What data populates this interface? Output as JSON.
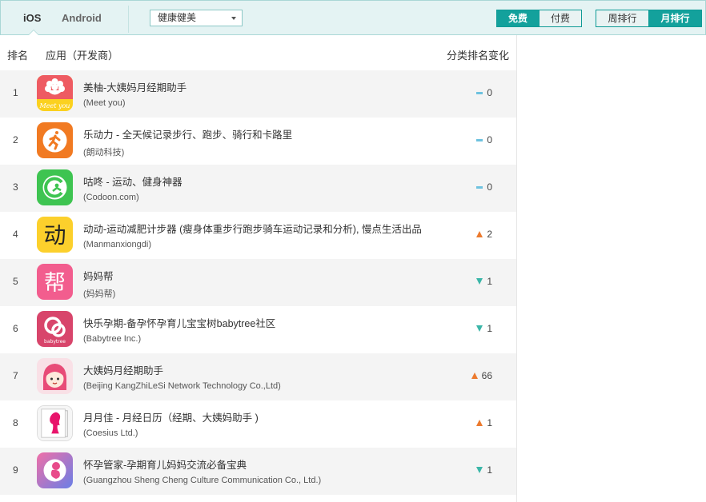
{
  "platform_tabs": [
    {
      "label": "iOS",
      "active": true
    },
    {
      "label": "Android",
      "active": false
    }
  ],
  "category_select": {
    "value": "健康健美"
  },
  "pay_toggle": [
    {
      "label": "免费",
      "active": true
    },
    {
      "label": "付费",
      "active": false
    }
  ],
  "period_toggle": [
    {
      "label": "周排行",
      "active": false
    },
    {
      "label": "月排行",
      "active": true
    }
  ],
  "table": {
    "headers": {
      "rank": "排名",
      "app": "应用（开发商）",
      "change": "分类排名变化"
    },
    "rows": [
      {
        "rank": "1",
        "name": "美柚-大姨妈月经期助手",
        "developer": "(Meet you)",
        "change_dir": "same",
        "change": "0",
        "icon": "meetyou-flower-icon"
      },
      {
        "rank": "2",
        "name": "乐动力 - 全天候记录步行、跑步、骑行和卡路里",
        "developer": "(朗动科技)",
        "change_dir": "same",
        "change": "0",
        "icon": "runner-icon"
      },
      {
        "rank": "3",
        "name": "咕咚 - 运动、健身神器",
        "developer": "(Codoon.com)",
        "change_dir": "same",
        "change": "0",
        "icon": "codoon-icon"
      },
      {
        "rank": "4",
        "name": "动动-运动减肥计步器 (瘦身体重步行跑步骑车运动记录和分析), 慢点生活出品",
        "developer": "(Manmanxiongdi)",
        "change_dir": "up",
        "change": "2",
        "icon": "dongdong-icon"
      },
      {
        "rank": "5",
        "name": "妈妈帮",
        "developer": "(妈妈帮)",
        "change_dir": "down",
        "change": "1",
        "icon": "mamabang-icon"
      },
      {
        "rank": "6",
        "name": "快乐孕期-备孕怀孕育儿宝宝树babytree社区",
        "developer": "(Babytree Inc.)",
        "change_dir": "down",
        "change": "1",
        "icon": "babytree-icon"
      },
      {
        "rank": "7",
        "name": "大姨妈月经期助手",
        "developer": "(Beijing KangZhiLeSi Network Technology Co.,Ltd)",
        "change_dir": "up",
        "change": "66",
        "icon": "girl-face-icon"
      },
      {
        "rank": "8",
        "name": "月月佳 - 月经日历（经期、大姨妈助手 )",
        "developer": "(Coesius Ltd.)",
        "change_dir": "up",
        "change": "1",
        "icon": "woman-silhouette-icon"
      },
      {
        "rank": "9",
        "name": "怀孕管家-孕期育儿妈妈交流必备宝典",
        "developer": "(Guangzhou Sheng Cheng Culture Communication Co., Ltd.)",
        "change_dir": "down",
        "change": "1",
        "icon": "fetus-icon"
      }
    ]
  },
  "colors": {
    "accent": "#13a19c",
    "up": "#ec7a2e",
    "down": "#3bb6a8",
    "same": "#6ec2df"
  }
}
